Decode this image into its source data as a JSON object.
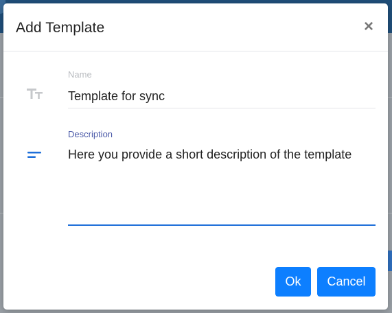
{
  "dialog": {
    "title": "Add Template",
    "close_glyph": "×"
  },
  "fields": {
    "name": {
      "label": "Name",
      "value": "Template for sync",
      "icon": "text-size-icon"
    },
    "description": {
      "label": "Description",
      "value": "Here you provide a short description of the template",
      "icon": "short-text-icon"
    }
  },
  "actions": {
    "ok_label": "Ok",
    "cancel_label": "Cancel"
  },
  "colors": {
    "accent": "#0d7fff",
    "focus_label": "#4a59a8",
    "focus_underline": "#1e6fd9",
    "muted_label": "#b9bcc0"
  }
}
